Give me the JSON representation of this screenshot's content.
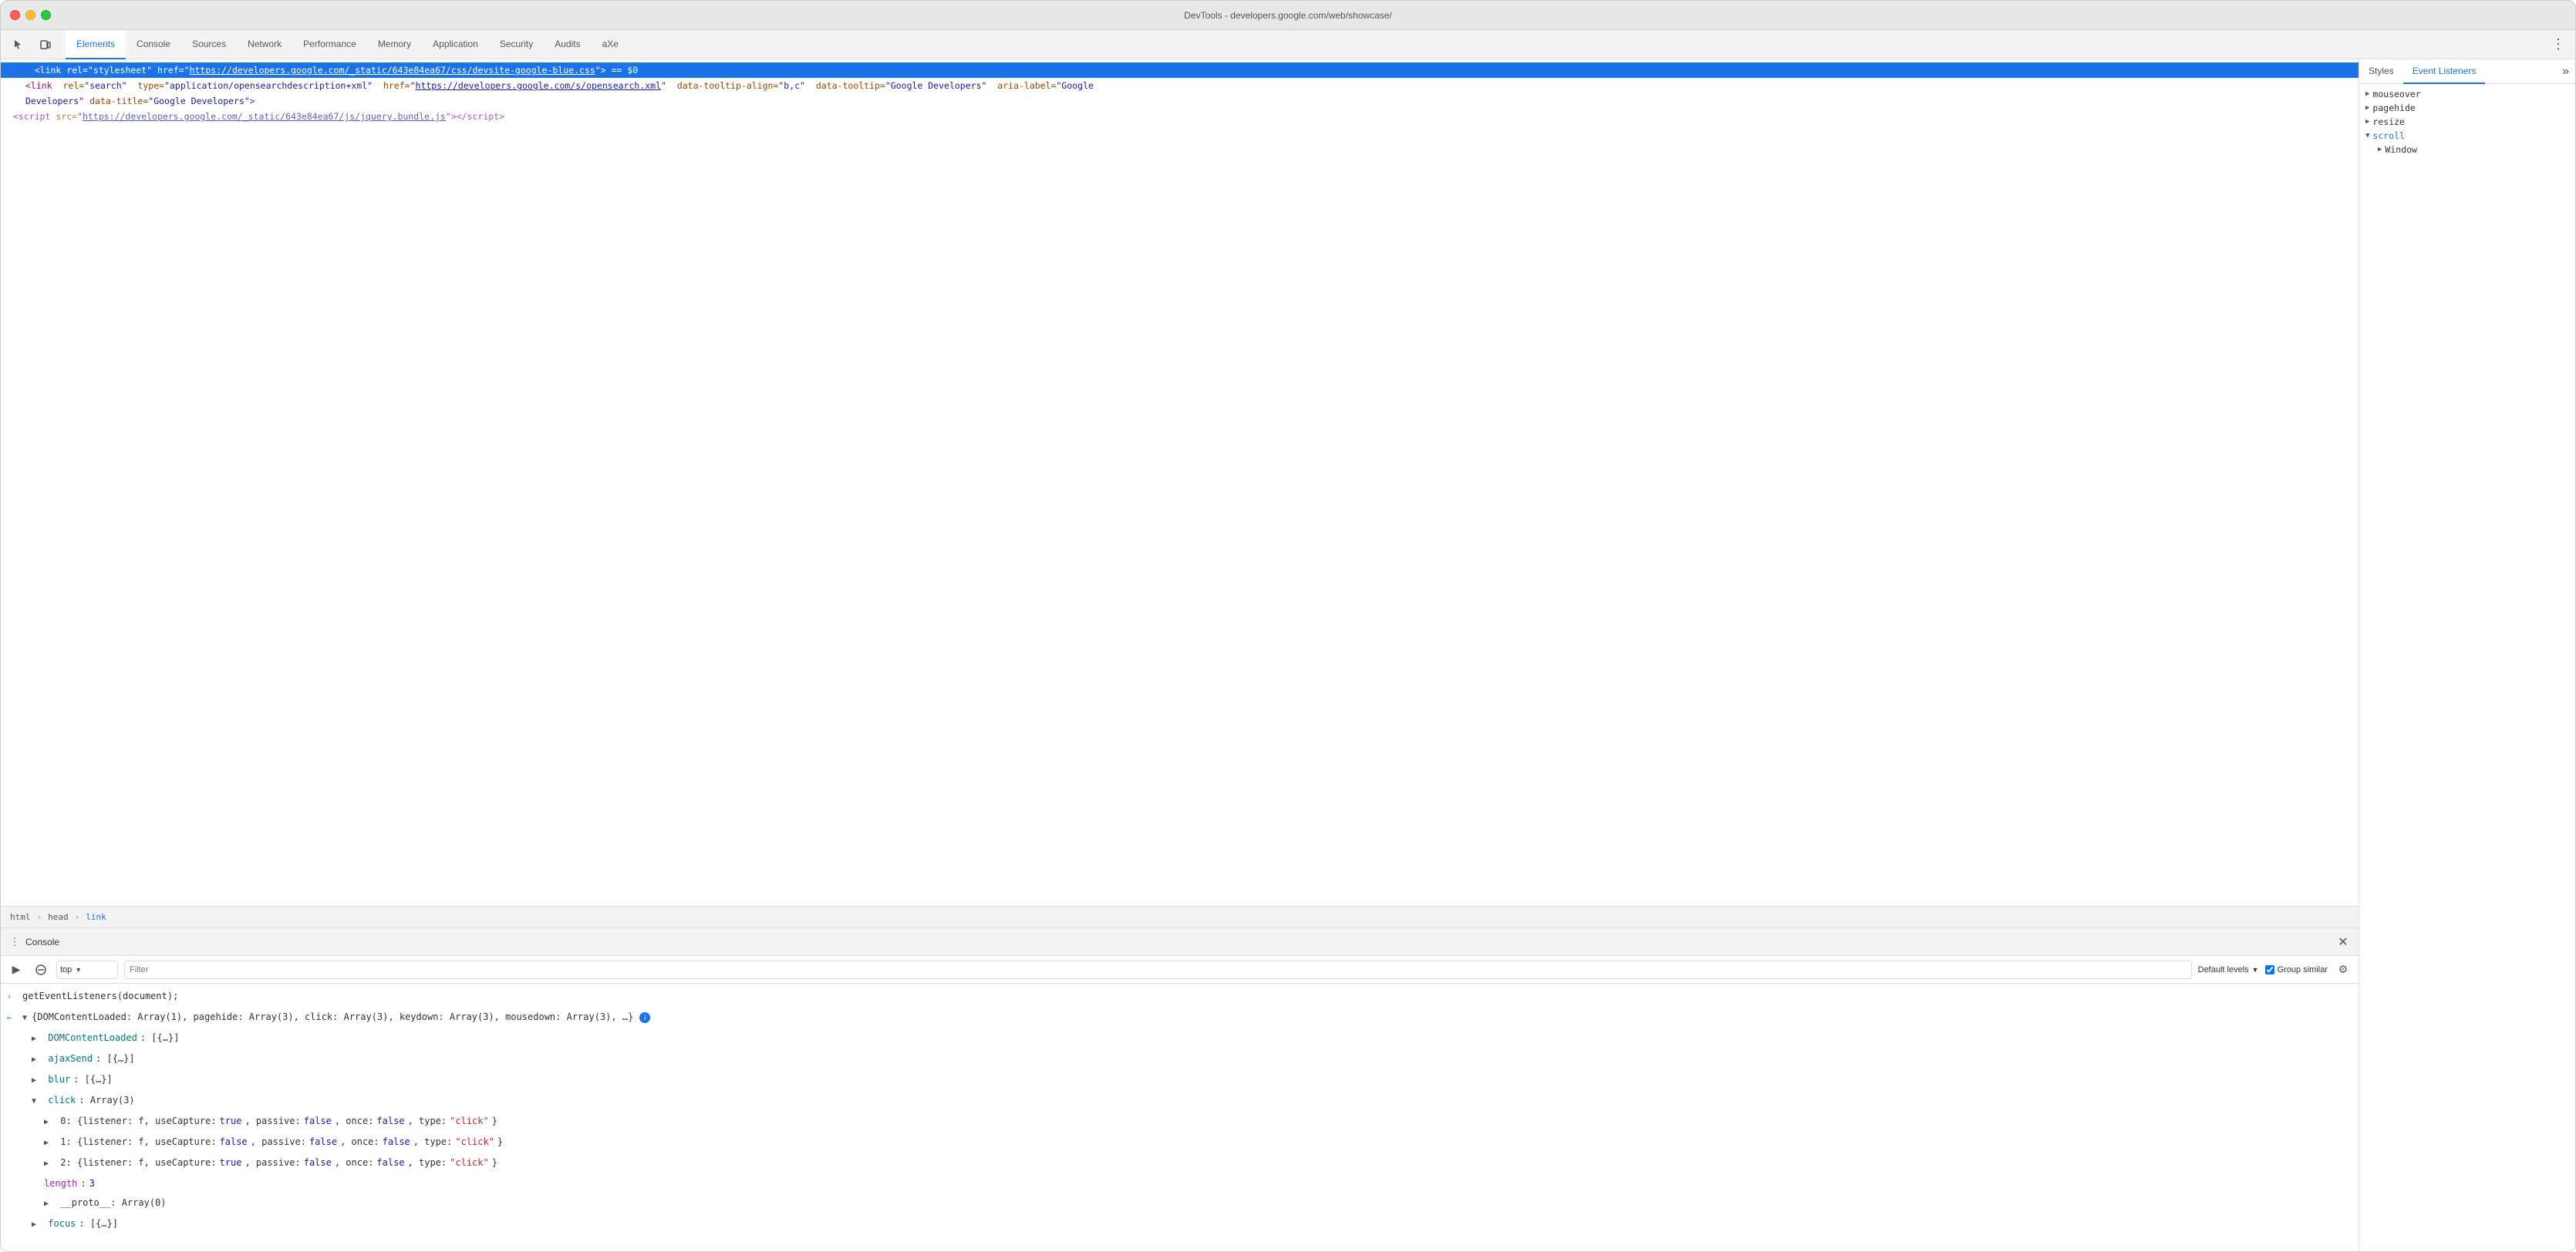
{
  "window": {
    "title": "DevTools - developers.google.com/web/showcase/"
  },
  "tabs": {
    "items": [
      {
        "label": "Elements",
        "active": true
      },
      {
        "label": "Console",
        "active": false
      },
      {
        "label": "Sources",
        "active": false
      },
      {
        "label": "Network",
        "active": false
      },
      {
        "label": "Performance",
        "active": false
      },
      {
        "label": "Memory",
        "active": false
      },
      {
        "label": "Application",
        "active": false
      },
      {
        "label": "Security",
        "active": false
      },
      {
        "label": "Audits",
        "active": false
      },
      {
        "label": "aXe",
        "active": false
      }
    ]
  },
  "elements": {
    "line1_prefix": "...",
    "line1": "<link rel=\"stylesheet\" href=\"",
    "line1_link": "https://developers.google.com/_static/643e84ea67/css/devsite-google-blue.css",
    "line1_suffix": "\"> == $0",
    "line2_start": "<link rel=\"search\" type=\"application/opensearchdescription+xml\" href=\"",
    "line2_link": "https://developers.google.com/s/opensearch.xml",
    "line2_suffix": "\" data-tooltip-align=\"b,c\" data-tooltip=\"Google Developers\" aria-label=\"Google Developers\" data-title=\"Google Developers\">",
    "line3": "<script src=\"https://developers.google.com/_static/643e84ea67/js/jquery.bundle.js\"></script>"
  },
  "breadcrumbs": [
    {
      "label": "html",
      "active": false
    },
    {
      "label": "head",
      "active": false
    },
    {
      "label": "link",
      "active": true
    }
  ],
  "styles_panel": {
    "tabs": [
      "Styles",
      "Event Listeners"
    ],
    "active_tab": "Event Listeners",
    "listeners": [
      {
        "name": "mouseover",
        "expanded": false
      },
      {
        "name": "pagehide",
        "expanded": false
      },
      {
        "name": "resize",
        "expanded": false
      },
      {
        "name": "scroll",
        "expanded": true
      },
      {
        "name": "Window",
        "is_child": true
      }
    ]
  },
  "console": {
    "title": "Console",
    "toolbar": {
      "execute_label": "▶",
      "clear_label": "⊘",
      "context_label": "top",
      "filter_placeholder": "Filter",
      "levels_label": "Default levels",
      "group_similar_label": "Group similar",
      "settings_label": "⚙"
    },
    "lines": [
      {
        "type": "input",
        "arrow": "›",
        "content": "getEventListeners(document);"
      },
      {
        "type": "object",
        "arrow": "←",
        "indent": 0,
        "content": "{DOMContentLoaded: Array(1), pagehide: Array(3), click: Array(3), keydown: Array(3), mousedown: Array(3), …}"
      },
      {
        "type": "prop",
        "indent": 1,
        "arrow": "▶",
        "prop": "DOMContentLoaded",
        "value": ": [{…}]"
      },
      {
        "type": "prop",
        "indent": 1,
        "arrow": "▶",
        "prop": "ajaxSend",
        "value": ": [{…}]"
      },
      {
        "type": "prop",
        "indent": 1,
        "arrow": "▶",
        "prop": "blur",
        "value": ": [{…}]"
      },
      {
        "type": "prop-expanded",
        "indent": 1,
        "arrow": "▼",
        "prop": "click",
        "value": ": Array(3)"
      },
      {
        "type": "click-0",
        "indent": 2,
        "arrow": "▶",
        "index": "0",
        "content": ": {listener: f, useCapture: true, passive: false, once: false, type: \"click\"}"
      },
      {
        "type": "click-1",
        "indent": 2,
        "arrow": "▶",
        "index": "1",
        "content": ": {listener: f, useCapture: false, passive: false, once: false, type: \"click\"}"
      },
      {
        "type": "click-2",
        "indent": 2,
        "arrow": "▶",
        "index": "2",
        "content": ": {listener: f, useCapture: true, passive: false, once: false, type: \"click\"}"
      },
      {
        "type": "length",
        "indent": 2,
        "prop": "length",
        "value": "3"
      },
      {
        "type": "proto",
        "indent": 2,
        "arrow": "▶",
        "prop": "__proto__",
        "value": ": Array(0)"
      },
      {
        "type": "prop",
        "indent": 1,
        "arrow": "▶",
        "prop": "focus",
        "value": ": [{…}]"
      }
    ]
  }
}
